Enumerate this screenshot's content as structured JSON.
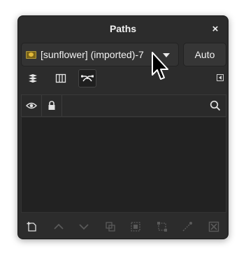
{
  "dialog": {
    "title": "Paths",
    "close_glyph": "×"
  },
  "image_selector": {
    "label": "[sunflower] (imported)-7",
    "thumbnail_icon": "image-thumbnail-icon",
    "auto_label": "Auto"
  },
  "tabs": [
    {
      "name": "layers-tab",
      "icon": "layers-icon",
      "active": false
    },
    {
      "name": "channels-tab",
      "icon": "channels-icon",
      "active": false
    },
    {
      "name": "paths-tab",
      "icon": "paths-icon",
      "active": true
    }
  ],
  "list_columns": {
    "visibility_icon": "eye-icon",
    "lock_icon": "lock-icon",
    "search_icon": "search-icon"
  },
  "bottom_actions": [
    {
      "name": "new-path-button",
      "icon": "new-path-icon",
      "enabled": true
    },
    {
      "name": "raise-path-button",
      "icon": "chevron-up-icon",
      "enabled": false
    },
    {
      "name": "lower-path-button",
      "icon": "chevron-down-icon",
      "enabled": false
    },
    {
      "name": "duplicate-path-button",
      "icon": "duplicate-icon",
      "enabled": false
    },
    {
      "name": "path-to-selection-button",
      "icon": "path-to-selection-icon",
      "enabled": false
    },
    {
      "name": "selection-to-path-button",
      "icon": "selection-to-path-icon",
      "enabled": false
    },
    {
      "name": "paint-along-path-button",
      "icon": "paint-along-path-icon",
      "enabled": false
    },
    {
      "name": "delete-path-button",
      "icon": "delete-icon",
      "enabled": false
    }
  ],
  "colors": {
    "window_bg": "#2c2c2c",
    "list_bg": "#222222",
    "text": "#f0f0f0",
    "disabled_icon": "#5a5a5a"
  }
}
